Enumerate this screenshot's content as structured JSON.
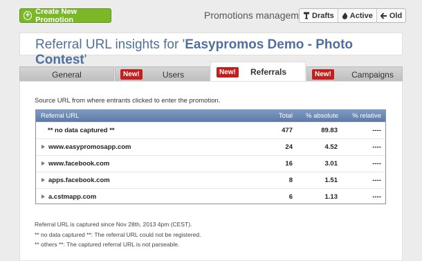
{
  "toolbar": {
    "create_label": "Create New Promotion",
    "title": "Promotions management",
    "filters": [
      {
        "label": "Drafts",
        "icon": "brush-icon"
      },
      {
        "label": "Active",
        "icon": "flame-icon"
      },
      {
        "label": "Old",
        "icon": "back-arrow-icon"
      }
    ]
  },
  "header": {
    "prefix": "Referral URL insights for '",
    "promo_name": "Easypromos Demo - Photo Contest",
    "suffix": "'"
  },
  "tabs": [
    {
      "label": "General",
      "badge": ""
    },
    {
      "label": "Users",
      "badge": "New!"
    },
    {
      "label": "Referrals",
      "badge": "New!",
      "active": true
    },
    {
      "label": "Campaigns",
      "badge": "New!"
    }
  ],
  "content": {
    "intro": "Source URL from where entrants clicked to enter the promotion.",
    "table": {
      "headers": [
        "Referral URL",
        "Total",
        "% absolute",
        "% relative"
      ],
      "rows": [
        {
          "url": "** no data captured **",
          "total": "477",
          "abs": "89.83",
          "rel": "----",
          "expandable": false
        },
        {
          "url": "www.easypromosapp.com",
          "total": "24",
          "abs": "4.52",
          "rel": "----",
          "expandable": true
        },
        {
          "url": "www.facebook.com",
          "total": "16",
          "abs": "3.01",
          "rel": "----",
          "expandable": true
        },
        {
          "url": "apps.facebook.com",
          "total": "8",
          "abs": "1.51",
          "rel": "----",
          "expandable": true
        },
        {
          "url": "a.cstmapp.com",
          "total": "6",
          "abs": "1.13",
          "rel": "----",
          "expandable": true
        }
      ]
    },
    "notes": [
      "Referral URL is captured since Nov 28th, 2013 4pm (CEST).",
      "** no data captured **: The referral URL could not be registered.",
      "** others **: The captured referral URL is not parseable."
    ]
  },
  "colors": {
    "accent_green": "#7ab827",
    "header_blue": "#4f6f9d",
    "badge_red": "#c31f1f",
    "table_header": "#6b86b3"
  }
}
